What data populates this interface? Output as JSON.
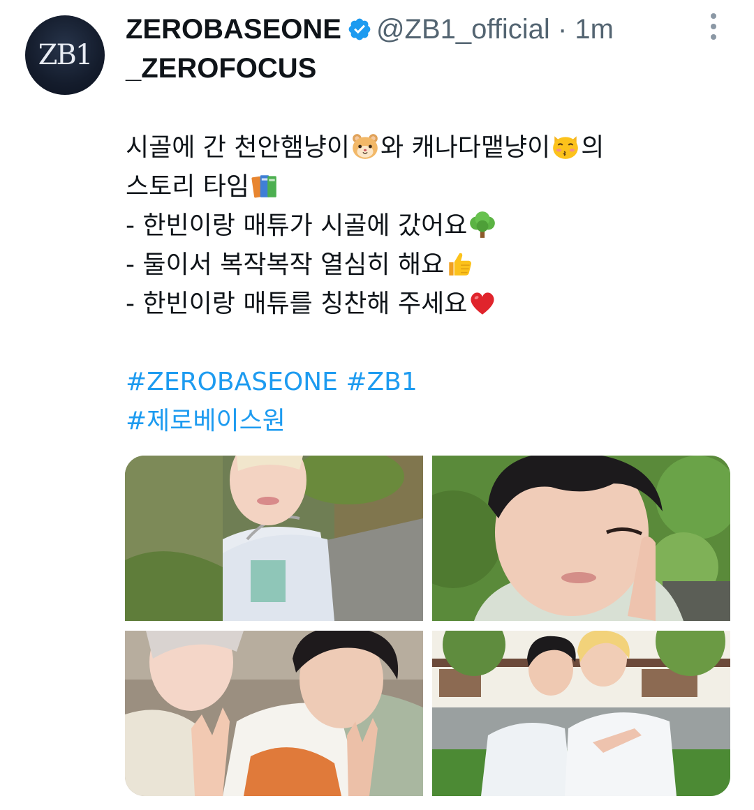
{
  "account": {
    "avatar_text": "ZB1",
    "display_name": "ZEROBASEONE",
    "handle": "@ZB1_official",
    "separator": "·",
    "time": "1m",
    "subline": "_ZEROFOCUS"
  },
  "tweet": {
    "line1_a": "시골에 간 천안햄냥이",
    "line1_b": "와 캐나다맽냥이",
    "line1_c": "의",
    "line2": "스토리 타임",
    "line3": "- 한빈이랑 매튜가 시골에 갔어요",
    "line4": "- 둘이서 복작복작 열심히 해요",
    "line5": "- 한빈이랑 매튜를 칭찬해 주세요",
    "hashtags": [
      "#ZEROBASEONE",
      "#ZB1",
      "#제로베이스원"
    ]
  },
  "icons": {
    "verified": "verified-badge-icon",
    "more": "more-vertical-icon",
    "emoji_hamster": "hamster-face-emoji",
    "emoji_cat": "kissing-cat-emoji",
    "emoji_books": "books-emoji",
    "emoji_tree": "deciduous-tree-emoji",
    "emoji_thumbs": "thumbs-up-emoji",
    "emoji_heart": "red-heart-emoji"
  },
  "colors": {
    "link": "#1d9bf0",
    "secondary_text": "#536471",
    "verified": "#1d9bf0",
    "avatar_bg": "#141c2c"
  }
}
